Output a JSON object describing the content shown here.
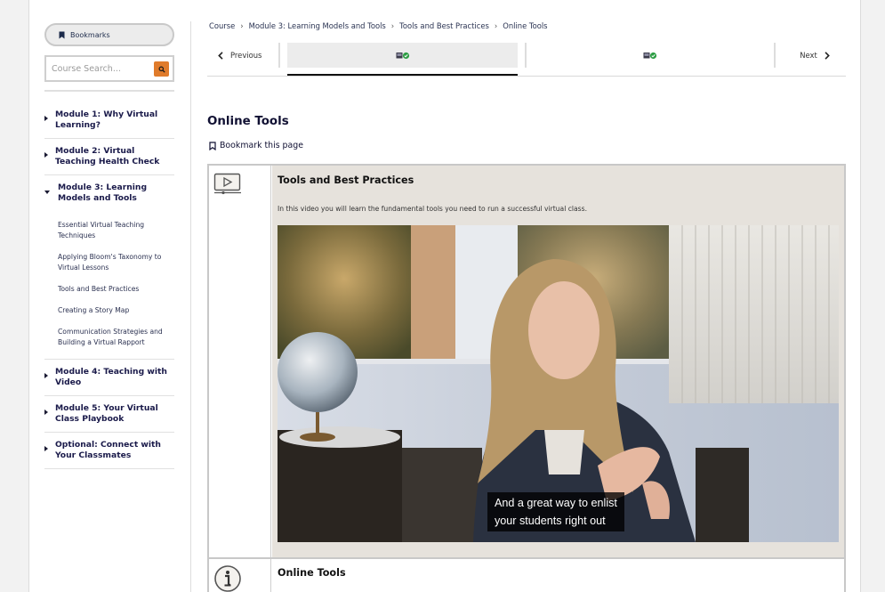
{
  "sidebar": {
    "bookmarks_label": "Bookmarks",
    "search": {
      "placeholder": "Course Search..."
    },
    "modules": [
      {
        "title": "Module 1: Why Virtual Learning?",
        "open": false
      },
      {
        "title": "Module 2: Virtual Teaching Health Check",
        "open": false
      },
      {
        "title": "Module 3: Learning Models and Tools",
        "open": true,
        "lessons": [
          "Essential Virtual Teaching Techniques",
          "Applying Bloom's Taxonomy to Virtual Lessons",
          "Tools and Best Practices",
          "Creating a Story Map",
          "Communication Strategies and Building a Virtual Rapport"
        ]
      },
      {
        "title": "Module 4: Teaching with Video",
        "open": false
      },
      {
        "title": "Module 5: Your Virtual Class Playbook",
        "open": false
      },
      {
        "title": "Optional: Connect with Your Classmates",
        "open": false
      }
    ]
  },
  "breadcrumb": [
    "Course",
    "Module 3: Learning Models and Tools",
    "Tools and Best Practices",
    "Online Tools"
  ],
  "nav": {
    "previous_label": "Previous",
    "next_label": "Next"
  },
  "page": {
    "title": "Online Tools",
    "bookmark_link": "Bookmark this page"
  },
  "video_section": {
    "title": "Tools and Best Practices",
    "description": "In this video you will learn the fundamental tools you need to run a successful virtual class.",
    "caption_line1": "And a great way to enlist",
    "caption_line2": "your students right out"
  },
  "info_section": {
    "title": "Online Tools"
  },
  "colors": {
    "search_button": "#e07b2b",
    "check": "#2e9e45",
    "panel": "#e6e2dc"
  }
}
